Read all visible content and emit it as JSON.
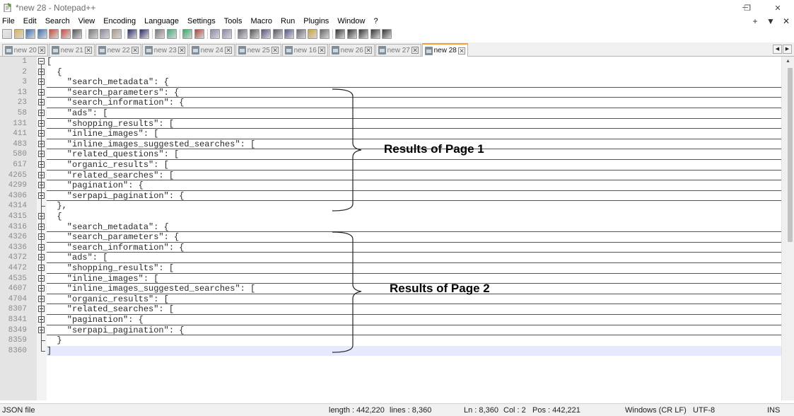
{
  "window": {
    "title": "*new 28 - Notepad++",
    "controls": {
      "minimize": "─",
      "maximize": "❐",
      "close": "✕"
    }
  },
  "menu": {
    "items": [
      "File",
      "Edit",
      "Search",
      "View",
      "Encoding",
      "Language",
      "Settings",
      "Tools",
      "Macro",
      "Run",
      "Plugins",
      "Window",
      "?"
    ],
    "right": [
      "+",
      "▼",
      "✕"
    ]
  },
  "toolbar": {
    "icons": [
      "new-file-icon",
      "open-file-icon",
      "save-icon",
      "save-all-icon",
      "close-icon",
      "close-all-icon",
      "print-icon",
      "cut-icon",
      "copy-icon",
      "paste-icon",
      "undo-icon",
      "redo-icon",
      "find-icon",
      "replace-icon",
      "zoom-in-icon",
      "zoom-out-icon",
      "sync-v-icon",
      "sync-h-icon",
      "word-wrap-icon",
      "all-chars-icon",
      "indent-guide-icon",
      "udl-icon",
      "doc-map-icon",
      "function-list-icon",
      "folder-workspace-icon",
      "monitor-icon",
      "record-macro-icon",
      "stop-macro-icon",
      "play-macro-icon",
      "run-macro-multiple-icon",
      "save-macro-icon"
    ]
  },
  "tabs": [
    {
      "label": "new 20",
      "active": false
    },
    {
      "label": "new 21",
      "active": false
    },
    {
      "label": "new 22",
      "active": false
    },
    {
      "label": "new 23",
      "active": false
    },
    {
      "label": "new 24",
      "active": false
    },
    {
      "label": "new 25",
      "active": false
    },
    {
      "label": "new 16",
      "active": false
    },
    {
      "label": "new 26",
      "active": false
    },
    {
      "label": "new 27",
      "active": false
    },
    {
      "label": "new 28",
      "active": true
    }
  ],
  "editor": {
    "lines": [
      {
        "num": "1",
        "text": "[",
        "fold": "open-top"
      },
      {
        "num": "2",
        "text": "  {",
        "fold": "open"
      },
      {
        "num": "3",
        "text": "    \"search_metadata\": {",
        "fold": "collapsed"
      },
      {
        "num": "13",
        "text": "    \"search_parameters\": {",
        "fold": "collapsed"
      },
      {
        "num": "23",
        "text": "    \"search_information\": {",
        "fold": "collapsed"
      },
      {
        "num": "58",
        "text": "    \"ads\": [",
        "fold": "collapsed"
      },
      {
        "num": "131",
        "text": "    \"shopping_results\": [",
        "fold": "collapsed"
      },
      {
        "num": "411",
        "text": "    \"inline_images\": [",
        "fold": "collapsed"
      },
      {
        "num": "483",
        "text": "    \"inline_images_suggested_searches\": [",
        "fold": "collapsed"
      },
      {
        "num": "580",
        "text": "    \"related_questions\": [",
        "fold": "collapsed"
      },
      {
        "num": "617",
        "text": "    \"organic_results\": [",
        "fold": "collapsed"
      },
      {
        "num": "4265",
        "text": "    \"related_searches\": [",
        "fold": "collapsed"
      },
      {
        "num": "4299",
        "text": "    \"pagination\": {",
        "fold": "collapsed"
      },
      {
        "num": "4306",
        "text": "    \"serpapi_pagination\": {",
        "fold": "collapsed"
      },
      {
        "num": "4314",
        "text": "  },",
        "fold": "end"
      },
      {
        "num": "4315",
        "text": "  {",
        "fold": "open"
      },
      {
        "num": "4316",
        "text": "    \"search_metadata\": {",
        "fold": "collapsed"
      },
      {
        "num": "4326",
        "text": "    \"search_parameters\": {",
        "fold": "collapsed"
      },
      {
        "num": "4336",
        "text": "    \"search_information\": {",
        "fold": "collapsed"
      },
      {
        "num": "4372",
        "text": "    \"ads\": [",
        "fold": "collapsed"
      },
      {
        "num": "4472",
        "text": "    \"shopping_results\": [",
        "fold": "collapsed"
      },
      {
        "num": "4535",
        "text": "    \"inline_images\": [",
        "fold": "collapsed"
      },
      {
        "num": "4607",
        "text": "    \"inline_images_suggested_searches\": [",
        "fold": "collapsed"
      },
      {
        "num": "4704",
        "text": "    \"organic_results\": [",
        "fold": "collapsed"
      },
      {
        "num": "8307",
        "text": "    \"related_searches\": [",
        "fold": "collapsed"
      },
      {
        "num": "8341",
        "text": "    \"pagination\": {",
        "fold": "collapsed"
      },
      {
        "num": "8349",
        "text": "    \"serpapi_pagination\": {",
        "fold": "collapsed"
      },
      {
        "num": "8359",
        "text": "  }",
        "fold": "end"
      },
      {
        "num": "8360",
        "text": "]",
        "fold": "end-top",
        "current": true
      }
    ]
  },
  "annotations": {
    "page1": "Results of Page 1",
    "page2": "Results of Page 2"
  },
  "status": {
    "file_type": "JSON file",
    "length": "length : 442,220",
    "lines": "lines : 8,360",
    "ln": "Ln : 8,360",
    "col": "Col : 2",
    "pos": "Pos : 442,221",
    "eol": "Windows (CR LF)",
    "encoding": "UTF-8",
    "mode": "INS"
  },
  "colors": {
    "active_tab_accent": "#fa9c31",
    "gutter": "#e4e4e4",
    "current_line": "#e8e8ff"
  }
}
